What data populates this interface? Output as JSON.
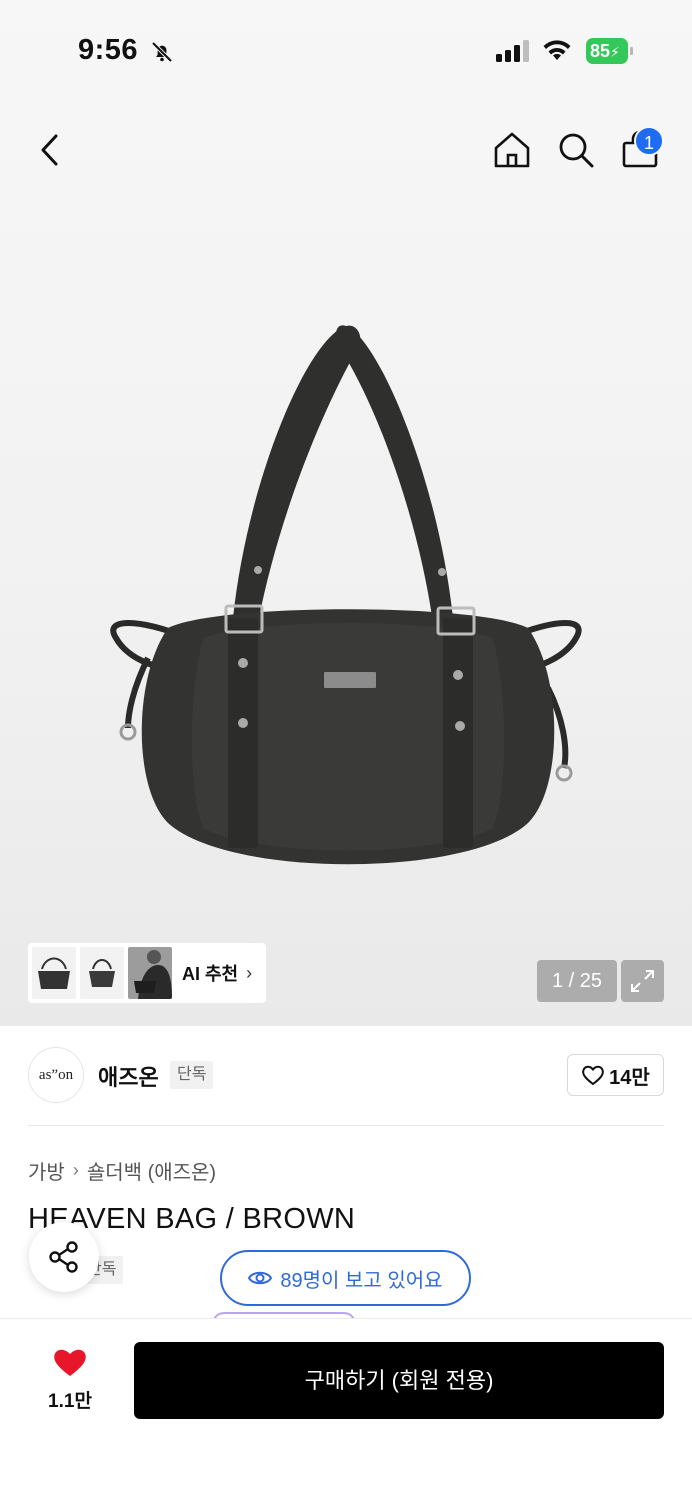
{
  "status_bar": {
    "time": "9:56",
    "battery": "85",
    "icons": [
      "bell-slash-icon",
      "signal-icon",
      "wifi-icon",
      "battery-charging-icon"
    ]
  },
  "nav": {
    "icons": [
      "back-chevron-icon",
      "home-icon",
      "search-icon",
      "shopping-bag-icon"
    ],
    "cart_badge": "1"
  },
  "gallery": {
    "ai_label": "AI 추천",
    "counter": "1 / 25"
  },
  "brand": {
    "logo_text": "as”on",
    "name": "애즈온",
    "tag": "단독"
  },
  "likes": {
    "count": "14만"
  },
  "breadcrumb": {
    "level1": "가방",
    "level2": "숄더백 (애즈온)"
  },
  "product": {
    "title": "HEAVEN BAG / BROWN",
    "tag": "단독"
  },
  "viewers": {
    "text": "89명이 보고 있어요"
  },
  "bottom": {
    "wish_count": "1.1만",
    "buy_label": "구매하기 (회원 전용)"
  },
  "colors": {
    "accent_blue": "#2f6bd8",
    "badge_blue": "#1e6cf2",
    "heart_red": "#e8162a",
    "battery_green": "#34c759"
  }
}
